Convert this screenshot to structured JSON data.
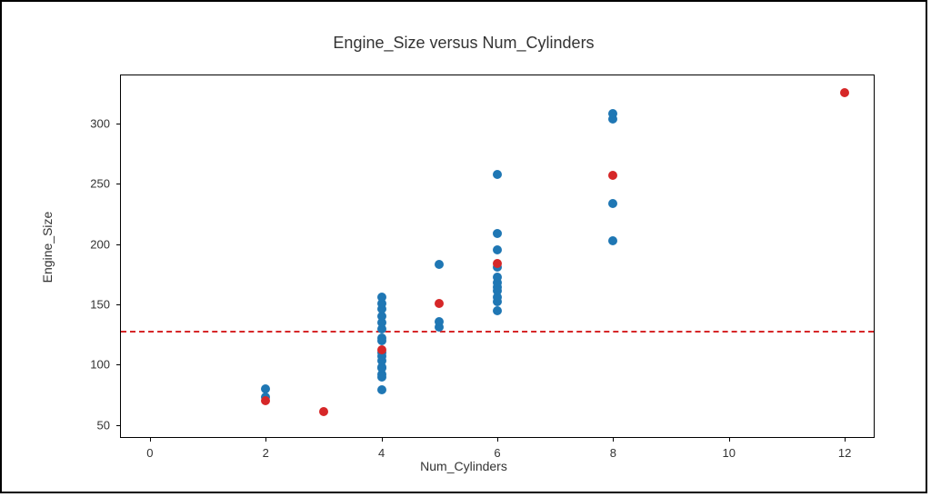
{
  "chart_data": {
    "type": "scatter",
    "title": "Engine_Size versus Num_Cylinders",
    "xlabel": "Num_Cylinders",
    "ylabel": "Engine_Size",
    "xlim": [
      -0.5,
      12.5
    ],
    "ylim": [
      40,
      340
    ],
    "x_ticks": [
      0,
      2,
      4,
      6,
      8,
      10,
      12
    ],
    "y_ticks": [
      50,
      100,
      150,
      200,
      250,
      300
    ],
    "hline": 128,
    "series": [
      {
        "name": "blue",
        "color": "#1f77b4",
        "points": [
          {
            "x": 2,
            "y": 73
          },
          {
            "x": 2,
            "y": 80
          },
          {
            "x": 4,
            "y": 79
          },
          {
            "x": 4,
            "y": 90
          },
          {
            "x": 4,
            "y": 92
          },
          {
            "x": 4,
            "y": 97
          },
          {
            "x": 4,
            "y": 98
          },
          {
            "x": 4,
            "y": 103
          },
          {
            "x": 4,
            "y": 107
          },
          {
            "x": 4,
            "y": 110
          },
          {
            "x": 4,
            "y": 120
          },
          {
            "x": 4,
            "y": 122
          },
          {
            "x": 4,
            "y": 130
          },
          {
            "x": 4,
            "y": 135
          },
          {
            "x": 4,
            "y": 140
          },
          {
            "x": 4,
            "y": 146
          },
          {
            "x": 4,
            "y": 151
          },
          {
            "x": 4,
            "y": 156
          },
          {
            "x": 5,
            "y": 131
          },
          {
            "x": 5,
            "y": 136
          },
          {
            "x": 5,
            "y": 183
          },
          {
            "x": 6,
            "y": 145
          },
          {
            "x": 6,
            "y": 152
          },
          {
            "x": 6,
            "y": 156
          },
          {
            "x": 6,
            "y": 161
          },
          {
            "x": 6,
            "y": 164
          },
          {
            "x": 6,
            "y": 168
          },
          {
            "x": 6,
            "y": 173
          },
          {
            "x": 6,
            "y": 181
          },
          {
            "x": 6,
            "y": 195
          },
          {
            "x": 6,
            "y": 209
          },
          {
            "x": 6,
            "y": 258
          },
          {
            "x": 8,
            "y": 203
          },
          {
            "x": 8,
            "y": 234
          },
          {
            "x": 8,
            "y": 304
          },
          {
            "x": 8,
            "y": 308
          }
        ]
      },
      {
        "name": "red",
        "color": "#d62728",
        "points": [
          {
            "x": 2,
            "y": 70
          },
          {
            "x": 3,
            "y": 61
          },
          {
            "x": 4,
            "y": 112
          },
          {
            "x": 5,
            "y": 151
          },
          {
            "x": 6,
            "y": 184
          },
          {
            "x": 8,
            "y": 257
          },
          {
            "x": 12,
            "y": 326
          }
        ]
      }
    ]
  }
}
